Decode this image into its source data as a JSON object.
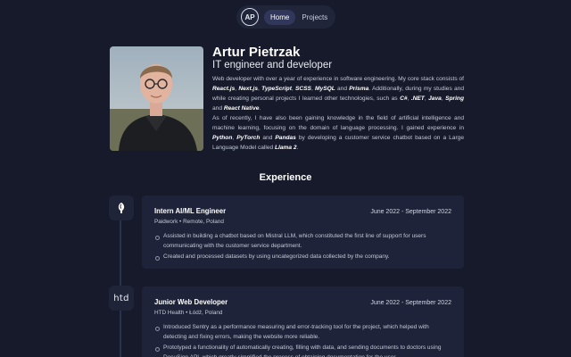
{
  "nav": {
    "logo": "AP",
    "links": [
      "Home",
      "Projects"
    ]
  },
  "profile": {
    "name": "Artur Pietrzak",
    "role": "IT engineer and developer",
    "bio1": [
      {
        "t": "Web developer with over a year of experience in software engineering. My core stack consists of "
      },
      {
        "t": "React.js",
        "b": true
      },
      {
        "t": ", "
      },
      {
        "t": "Next.js",
        "b": true
      },
      {
        "t": ", "
      },
      {
        "t": "TypeScript",
        "b": true
      },
      {
        "t": ", "
      },
      {
        "t": "SCSS",
        "b": true
      },
      {
        "t": ", "
      },
      {
        "t": "MySQL",
        "b": true
      },
      {
        "t": " and "
      },
      {
        "t": "Prisma",
        "b": true
      },
      {
        "t": ". Additionally, during my studies and while creating personal projects I learned other technologies, such as "
      },
      {
        "t": "C#",
        "b": true
      },
      {
        "t": ", "
      },
      {
        "t": ".NET",
        "b": true
      },
      {
        "t": ", "
      },
      {
        "t": "Java",
        "b": true
      },
      {
        "t": ", "
      },
      {
        "t": "Spring",
        "b": true
      },
      {
        "t": " and "
      },
      {
        "t": "React Native",
        "b": true
      },
      {
        "t": "."
      }
    ],
    "bio2": [
      {
        "t": "As of recently, I have also been gaining knowledge in the field of artificial intelligence and machine learning, focusing on the domain of language processing. I gained experience in "
      },
      {
        "t": "Python",
        "b": true
      },
      {
        "t": ", "
      },
      {
        "t": "PyTorch",
        "b": true
      },
      {
        "t": " and "
      },
      {
        "t": "Pandas",
        "b": true
      },
      {
        "t": " by developing a customer service chatbot based on a Large Language Model called "
      },
      {
        "t": "Llama 2",
        "b": true
      },
      {
        "t": "."
      }
    ]
  },
  "experience": {
    "title": "Experience",
    "jobs": [
      {
        "icon": "paidwork-logo-icon",
        "title": "Intern AI/ML Engineer",
        "date": "June 2022 - September 2022",
        "company": "Paidwork • Remote, Poland",
        "bullets": [
          "Assisted in building a chatbot based on Mistral LLM, which constituted the first line of support for users communicating with the customer service department.",
          "Created and processed datasets by using uncategorized data collected by the company."
        ]
      },
      {
        "icon": "htd-logo-icon",
        "logo_text": "htd",
        "title": "Junior Web Developer",
        "date": "June 2022 - September 2022",
        "company": "HTD Health • Łódź, Poland",
        "bullets": [
          "Introduced Sentry as a performance measuring and error-tracking tool for the project, which helped with detecting and fixing errors, making the website more reliable.",
          "Prototyped a functionality of automatically creating, filling with data, and sending documents to doctors using DocuSign API, which greatly simplified the process of obtaining documentation for the user."
        ]
      }
    ]
  }
}
